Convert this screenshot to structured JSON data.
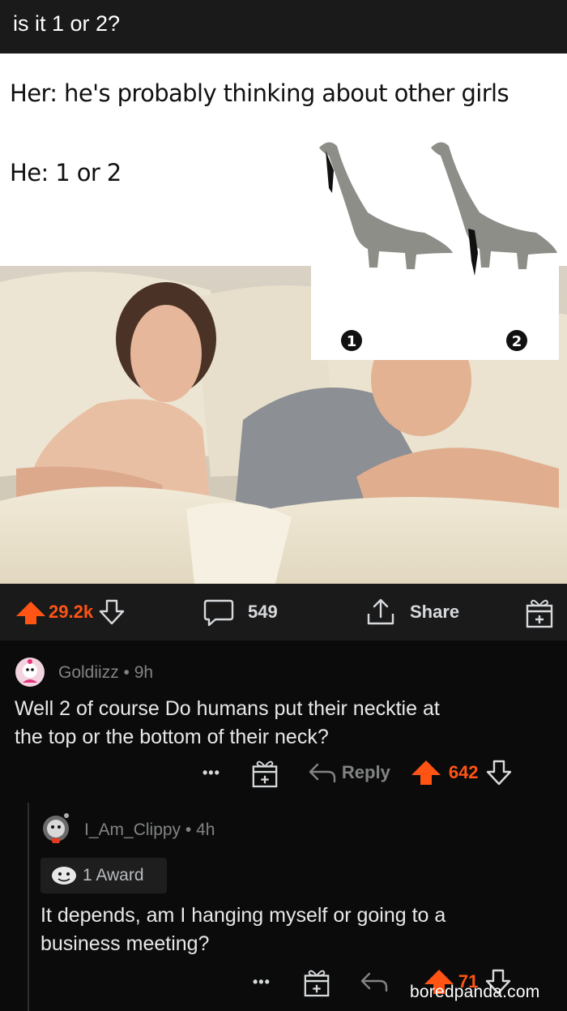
{
  "post": {
    "title": "is it 1 or 2?"
  },
  "meme": {
    "line1": "Her: he's probably thinking about other girls",
    "line2": "He: 1 or 2",
    "label_1": "1",
    "label_2": "2"
  },
  "actions": {
    "upvotes": "29.2k",
    "comments": "549",
    "share_label": "Share"
  },
  "comments": [
    {
      "username": "Goldiizz",
      "age": "9h",
      "body_line1": "Well 2 of course Do humans put their necktie at",
      "body_line2": "the top or the bottom of their neck?",
      "reply_label": "Reply",
      "score": "642",
      "more_label": "•••"
    },
    {
      "username": "I_Am_Clippy",
      "age": "4h",
      "award": "1 Award",
      "body_line1": "It depends, am I hanging myself or going to a",
      "body_line2": "business meeting?",
      "score": "71",
      "more_label": "•••"
    }
  ],
  "watermark": "boredpanda.com",
  "colors": {
    "upvote": "#ff5414",
    "bar_bg": "#1a1a1b",
    "page_bg": "#0b0b0b"
  }
}
